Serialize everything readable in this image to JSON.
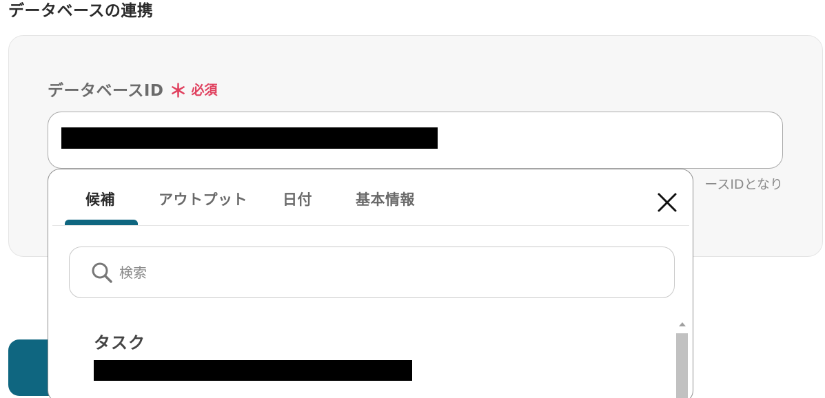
{
  "section": {
    "title": "データベースの連携"
  },
  "field": {
    "label": "データベースID",
    "required_mark": "＊",
    "required_text": "必須",
    "hint_partial": "ースIDとなり"
  },
  "dropdown": {
    "tabs": [
      {
        "label": "候補",
        "active": true
      },
      {
        "label": "アウトプット",
        "active": false
      },
      {
        "label": "日付",
        "active": false
      },
      {
        "label": "基本情報",
        "active": false
      }
    ],
    "close_icon": "close-icon",
    "search": {
      "placeholder": "検索",
      "value": "",
      "icon": "search-icon"
    },
    "items": [
      {
        "title": "タスク"
      }
    ]
  },
  "colors": {
    "accent": "#0f6680",
    "required": "#e0405e",
    "card_bg": "#f7f7f7"
  }
}
